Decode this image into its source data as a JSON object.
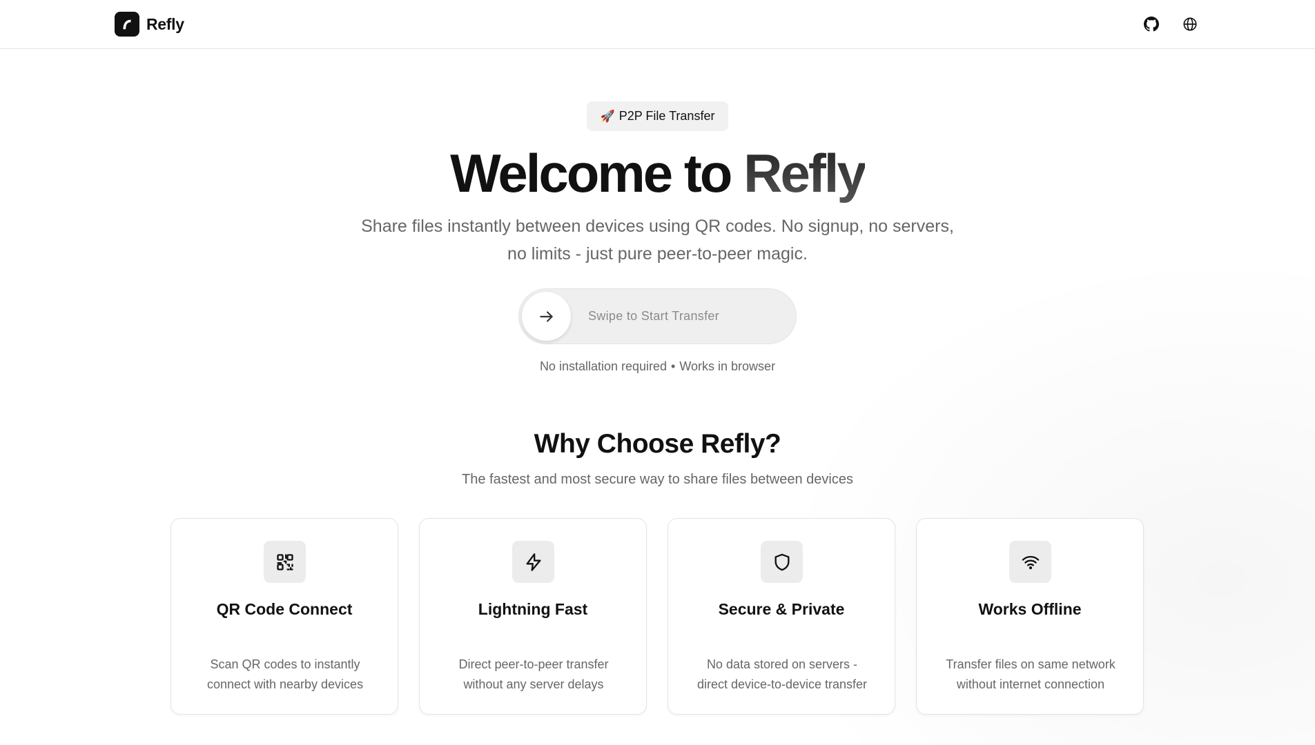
{
  "header": {
    "brand_name": "Refly",
    "icons": [
      "github-icon",
      "globe-icon"
    ]
  },
  "hero": {
    "badge_emoji": "🚀",
    "badge_label": "P2P File Transfer",
    "title_prefix": "Welcome to ",
    "title_accent": "Refly",
    "subtitle_line1": "Share files instantly between devices using QR codes. No signup, no servers,",
    "subtitle_line2": "no limits - just pure peer-to-peer magic.",
    "swipe_label": "Swipe to Start Transfer",
    "note_left": "No installation required",
    "note_separator": "•",
    "note_right": "Works in browser"
  },
  "features": {
    "title": "Why Choose Refly?",
    "subtitle": "The fastest and most secure way to share files between devices",
    "cards": [
      {
        "icon": "qr-code-icon",
        "title": "QR Code Connect",
        "desc_line1": "Scan QR codes to instantly",
        "desc_line2": "connect with nearby devices"
      },
      {
        "icon": "lightning-icon",
        "title": "Lightning Fast",
        "desc_line1": "Direct peer-to-peer transfer",
        "desc_line2": "without any server delays"
      },
      {
        "icon": "shield-icon",
        "title": "Secure & Private",
        "desc_line1": "No data stored on servers -",
        "desc_line2": "direct device-to-device transfer"
      },
      {
        "icon": "wifi-icon",
        "title": "Works Offline",
        "desc_line1": "Transfer files on same network",
        "desc_line2": "without internet connection"
      }
    ]
  },
  "colors": {
    "text": "#111111",
    "muted": "#666666",
    "surface": "#f1f1f1",
    "border": "#e3e3e3"
  }
}
